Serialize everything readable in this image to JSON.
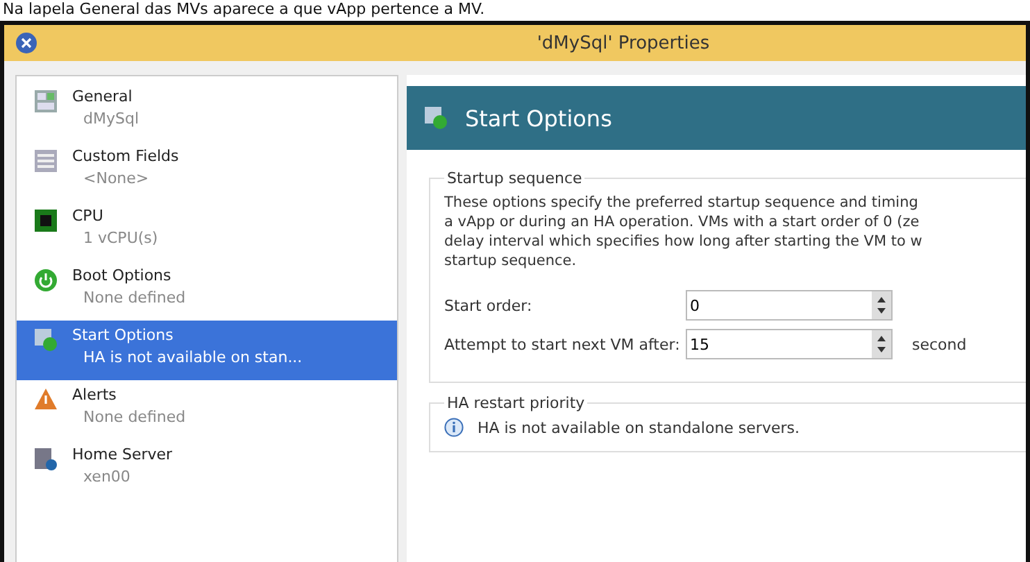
{
  "caption": "Na lapela General das MVs aparece a que vApp pertence a MV.",
  "window": {
    "title": "'dMySql' Properties"
  },
  "sidebar": {
    "items": [
      {
        "kind": "general",
        "label": "General",
        "sublabel": "dMySql",
        "selected": false
      },
      {
        "kind": "fields",
        "label": "Custom Fields",
        "sublabel": "<None>",
        "selected": false
      },
      {
        "kind": "cpu",
        "label": "CPU",
        "sublabel": "1 vCPU(s)",
        "selected": false
      },
      {
        "kind": "boot",
        "label": "Boot Options",
        "sublabel": "None defined",
        "selected": false
      },
      {
        "kind": "start",
        "label": "Start Options",
        "sublabel": "HA is not available on stan...",
        "selected": true
      },
      {
        "kind": "alert",
        "label": "Alerts",
        "sublabel": "None defined",
        "selected": false
      },
      {
        "kind": "server",
        "label": "Home Server",
        "sublabel": "xen00",
        "selected": false
      }
    ]
  },
  "panel": {
    "title": "Start Options",
    "startup": {
      "legend": "Startup sequence",
      "description": [
        "These options specify the preferred startup sequence and timing",
        "a vApp or during an HA operation. VMs with a start order of 0 (ze",
        "delay interval which specifies how long after starting the VM to w",
        "startup sequence."
      ],
      "fields": [
        {
          "label": "Start order:",
          "value": "0"
        },
        {
          "label": "Attempt to start next VM after:",
          "value": "15",
          "unit": "second"
        }
      ]
    },
    "ha": {
      "legend": "HA restart priority",
      "message": "HA is not available on standalone servers."
    }
  }
}
